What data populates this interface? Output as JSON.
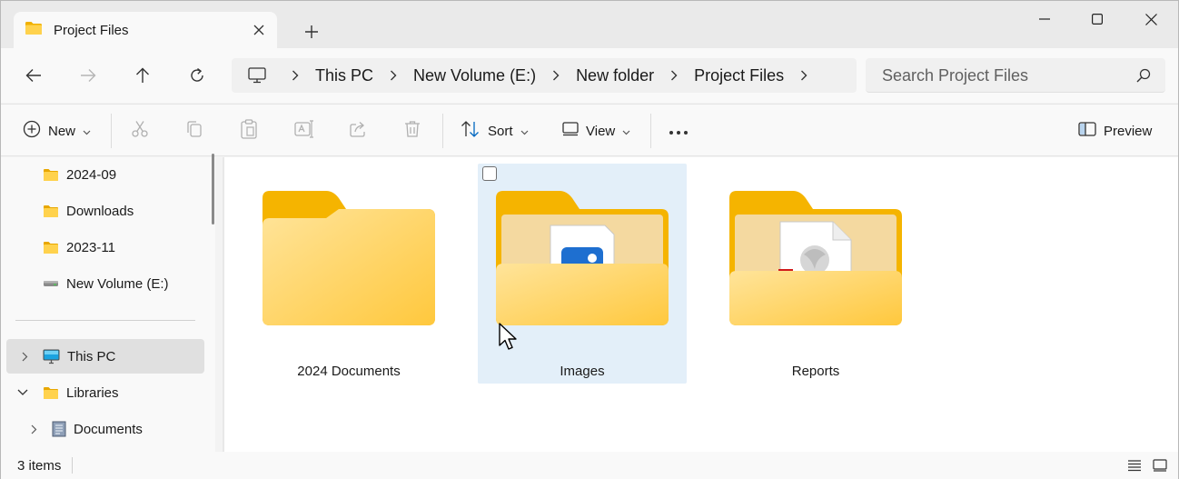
{
  "window": {
    "tab_title": "Project Files",
    "new_tab_symbol": "+",
    "controls": [
      "minimize-icon",
      "maximize-icon",
      "close-icon"
    ]
  },
  "address": {
    "root_icon": "computer-icon",
    "breadcrumbs": [
      "This PC",
      "New Volume (E:)",
      "New folder",
      "Project Files"
    ],
    "search_placeholder": "Search Project Files"
  },
  "toolbar": {
    "new_label": "New",
    "sort_label": "Sort",
    "view_label": "View",
    "more_symbol": "•••",
    "preview_label": "Preview",
    "icons": [
      "cut-icon",
      "copy-icon",
      "paste-icon",
      "rename-icon",
      "share-icon",
      "delete-icon"
    ]
  },
  "sidebar": {
    "items": [
      {
        "label": "2024-09",
        "icon": "folder-icon"
      },
      {
        "label": "Downloads",
        "icon": "folder-icon"
      },
      {
        "label": "2023-11",
        "icon": "folder-icon"
      },
      {
        "label": "New Volume (E:)",
        "icon": "drive-icon"
      },
      {
        "label": "This PC",
        "icon": "monitor-icon",
        "selected": true
      },
      {
        "label": "Libraries",
        "icon": "folder-icon",
        "expanded": true
      },
      {
        "label": "Documents",
        "icon": "documents-library-icon"
      }
    ]
  },
  "content": {
    "items": [
      {
        "name": "2024 Documents",
        "type": "folder"
      },
      {
        "name": "Images",
        "type": "folder",
        "selected": true
      },
      {
        "name": "Reports",
        "type": "folder"
      }
    ]
  },
  "status": {
    "item_count": "3 items"
  },
  "colors": {
    "folder_back": "#f5b400",
    "folder_front": "#ffd55c",
    "selection": "#e3eff9",
    "accent": "#005fb8"
  }
}
